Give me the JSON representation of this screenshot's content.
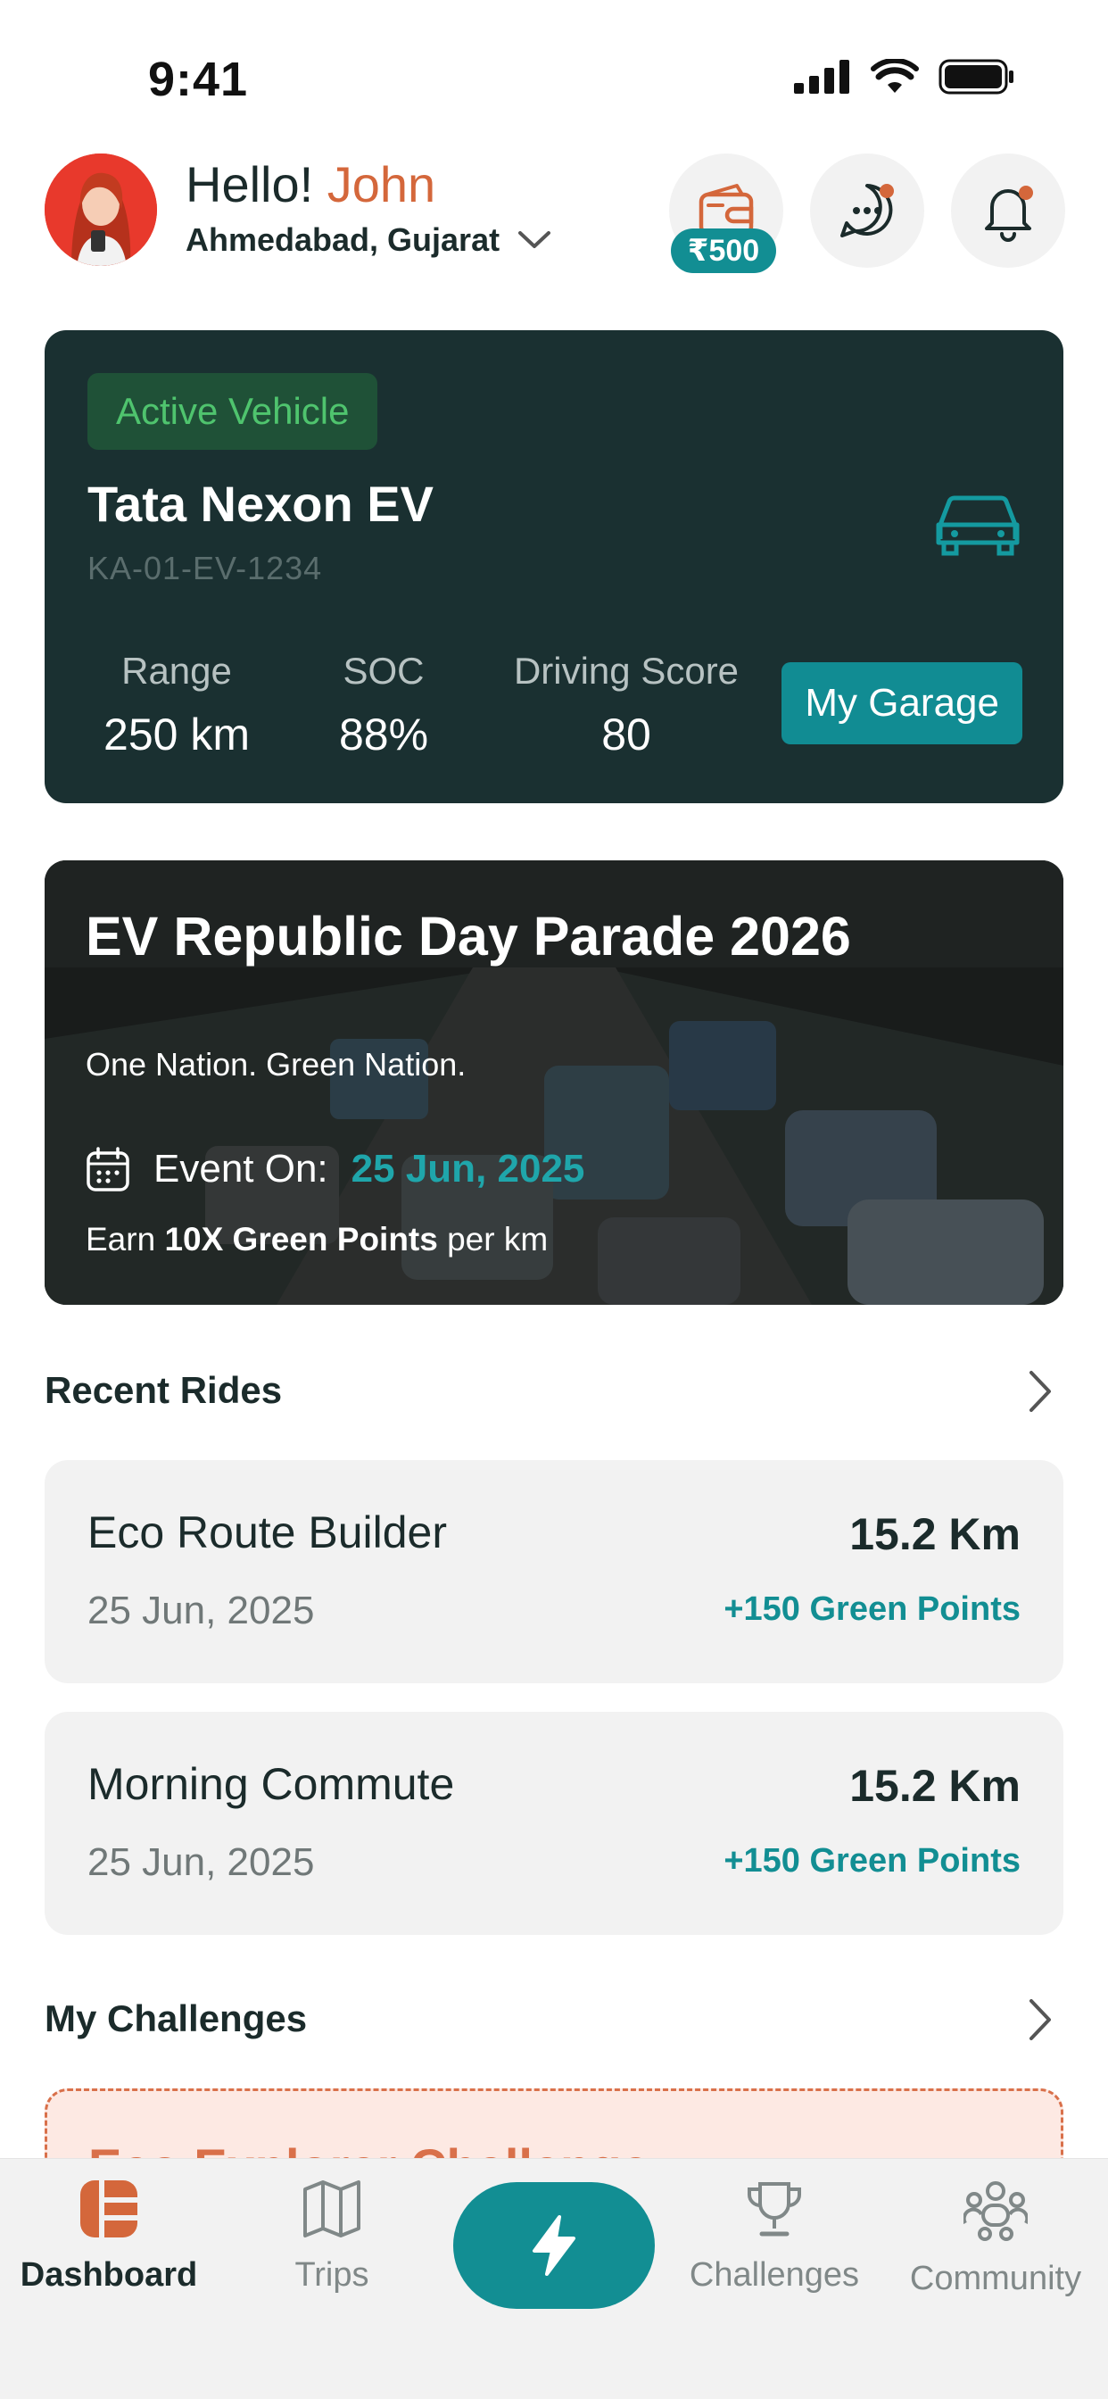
{
  "status_bar": {
    "time": "9:41"
  },
  "header": {
    "greeting": "Hello!",
    "user_name": "John",
    "location": "Ahmedabad, Gujarat",
    "wallet_amount": "₹500"
  },
  "vehicle": {
    "badge": "Active Vehicle",
    "name": "Tata Nexon EV",
    "plate": "KA-01-EV-1234",
    "stats": [
      {
        "label": "Range",
        "value": "250 km"
      },
      {
        "label": "SOC",
        "value": "88%"
      },
      {
        "label": "Driving Score",
        "value": "80"
      }
    ],
    "garage_button": "My Garage"
  },
  "event": {
    "title": "EV Republic Day Parade 2026",
    "subtitle": "One Nation. Green Nation.",
    "event_on_label": "Event On:",
    "date": "25 Jun, 2025",
    "earn_prefix": "Earn",
    "earn_highlight": "10X Green Points",
    "earn_suffix": "per km"
  },
  "recent_rides": {
    "title": "Recent Rides",
    "items": [
      {
        "name": "Eco Route Builder",
        "date": "25 Jun, 2025",
        "distance": "15.2 Km",
        "points": "+150 Green Points"
      },
      {
        "name": "Morning Commute",
        "date": "25 Jun, 2025",
        "distance": "15.2 Km",
        "points": "+150 Green Points"
      }
    ]
  },
  "challenges": {
    "title": "My Challenges",
    "first_card_title": "Eco Explorer Challenge"
  },
  "tabbar": {
    "tabs": [
      {
        "label": "Dashboard",
        "icon": "dashboard-icon",
        "active": true
      },
      {
        "label": "Trips",
        "icon": "map-icon"
      },
      {
        "label": "Challenges",
        "icon": "trophy-icon"
      },
      {
        "label": "Community",
        "icon": "community-icon"
      }
    ],
    "center_icon": "lightning-icon"
  },
  "colors": {
    "accent": "#128e93",
    "brand_orange": "#d4673b",
    "card_dark": "#1a3031"
  }
}
